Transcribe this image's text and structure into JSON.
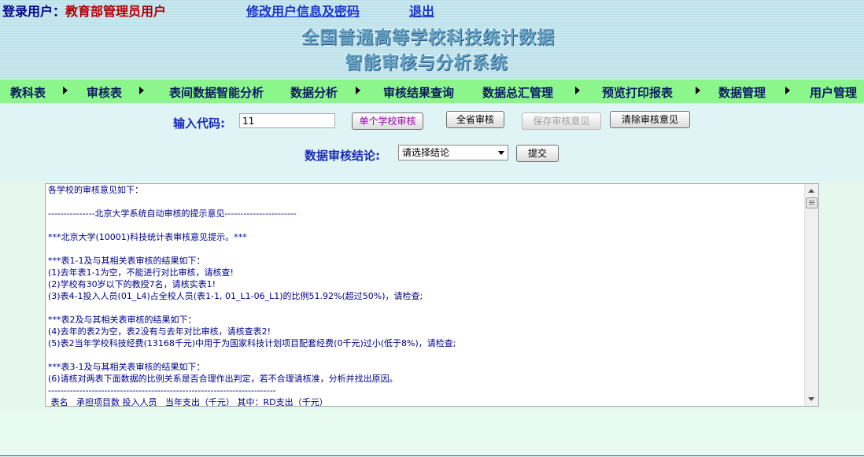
{
  "header": {
    "login_label": "登录用户：",
    "login_role": "教育部管理员用户",
    "edit_link": "修改用户信息及密码",
    "logout_link": "退出",
    "title_line1": "全国普通高等学校科技统计数据",
    "title_line2": "智能审核与分析系统"
  },
  "nav": {
    "items": [
      "教科表",
      "审核表",
      "表间数据智能分析",
      "数据分析",
      "审核结果查询",
      "数据总汇管理",
      "预览打印报表",
      "数据管理",
      "用户管理"
    ]
  },
  "controls": {
    "code_label": "输入代码:",
    "code_value": "11",
    "single_audit": "单个学校审核",
    "province_audit": "全省审核",
    "save_opinion": "保存审核意见",
    "clear_opinion": "清除审核意见",
    "conclusion_label": "数据审核结论:",
    "conclusion_select": "请选择结论",
    "submit": "提交"
  },
  "report": {
    "lines": [
      "各学校的审核意见如下：",
      "",
      "---------------北京大学系统自动审核的提示意见-----------------------",
      "",
      "***北京大学(10001)科技统计表审核意见提示。***",
      "",
      "***表1-1及与其相关表审核的结果如下：",
      "(1)去年表1-1为空，不能进行对比审核，请核查!",
      "(2)学校有30岁以下的教授7名，请核实表1!",
      "(3)表4-1投入人员(01_L4)占全校人员(表1-1, 01_L1-06_L1)的比例51.92%(超过50%)，请检查;",
      "",
      "***表2及与其相关表审核的结果如下：",
      "(4)去年的表2为空，表2没有与去年对比审核，请核查表2!",
      "(5)表2当年学校科技经费(13168千元)中用于为国家科技计划项目配套经费(0千元)过小(低于8%)，请检查;",
      "",
      "***表3-1及与其相关表审核的结果如下：",
      "(6)请核对两表下面数据的比例关系是否合理作出判定，若不合理请核准，分析并找出原因。",
      "-------------------------------------------------------------------------",
      " 表名   承担项目数 投入人员   当年支出（千元） 其中：RD支出（千元）"
    ]
  }
}
